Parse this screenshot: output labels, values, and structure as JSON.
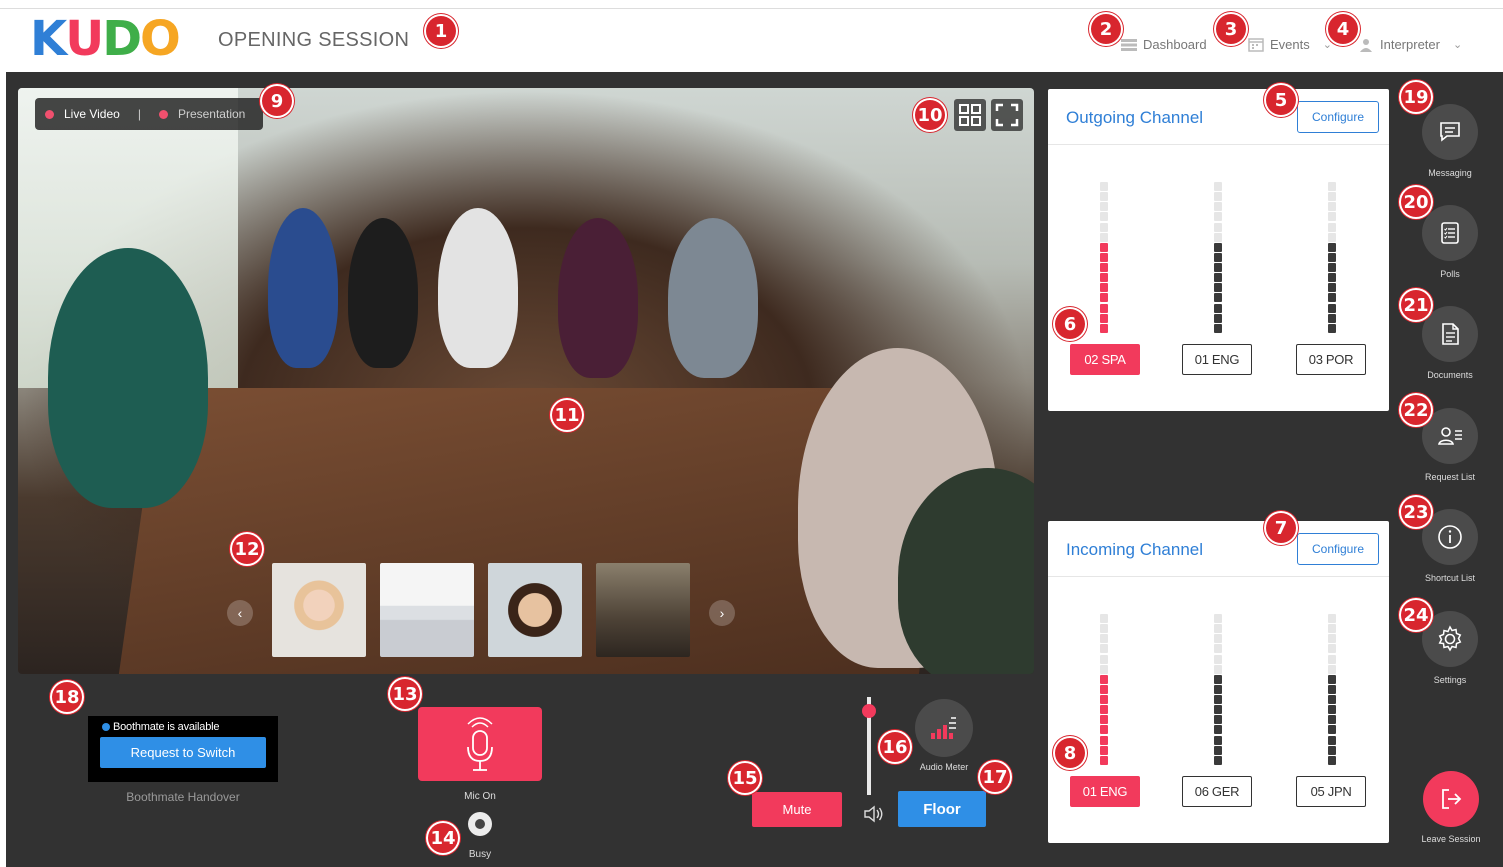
{
  "header": {
    "logo": [
      "K",
      "U",
      "D",
      "O"
    ],
    "logo_colors": [
      "#2f7fd6",
      "#f23a5c",
      "#3fae49",
      "#f6a623"
    ],
    "session_title": "OPENING SESSION",
    "nav": [
      {
        "label": "Dashboard",
        "icon": "dashboard-icon"
      },
      {
        "label": "Events",
        "icon": "calendar-icon"
      },
      {
        "label": "Interpreter",
        "icon": "user-icon"
      }
    ]
  },
  "video": {
    "toggle_live": "Live Video",
    "toggle_separator": "|",
    "toggle_presentation": "Presentation",
    "thumbnails_count": 4
  },
  "outgoing": {
    "title": "Outgoing Channel",
    "configure_label": "Configure",
    "channels": [
      {
        "label": "02 SPA",
        "active": true,
        "level": 0.6
      },
      {
        "label": "01 ENG",
        "active": false,
        "level": 0.6
      },
      {
        "label": "03 POR",
        "active": false,
        "level": 0.6
      }
    ]
  },
  "incoming": {
    "title": "Incoming Channel",
    "configure_label": "Configure",
    "channels": [
      {
        "label": "01 ENG",
        "active": true,
        "level": 0.6
      },
      {
        "label": "06 GER",
        "active": false,
        "level": 0.6
      },
      {
        "label": "05 JPN",
        "active": false,
        "level": 0.6
      }
    ]
  },
  "sidebar": {
    "items": [
      {
        "label": "Messaging",
        "icon": "message-icon"
      },
      {
        "label": "Polls",
        "icon": "polls-icon"
      },
      {
        "label": "Documents",
        "icon": "documents-icon"
      },
      {
        "label": "Request List",
        "icon": "request-list-icon"
      },
      {
        "label": "Shortcut List",
        "icon": "info-icon"
      },
      {
        "label": "Settings",
        "icon": "gear-icon"
      }
    ],
    "leave_label": "Leave Session"
  },
  "controls": {
    "boothmate_status": "Boothmate is available",
    "request_switch": "Request to Switch",
    "handover_label": "Boothmate Handover",
    "mic_label": "Mic On",
    "busy_label": "Busy",
    "mute_label": "Mute",
    "floor_label": "Floor",
    "audio_meter_label": "Audio Meter",
    "volume_level": 0.93
  },
  "badges": [
    "1",
    "2",
    "3",
    "4",
    "5",
    "6",
    "7",
    "8",
    "9",
    "10",
    "11",
    "12",
    "13",
    "14",
    "15",
    "16",
    "17",
    "18",
    "19",
    "20",
    "21",
    "22",
    "23",
    "24"
  ],
  "colors": {
    "accent_red": "#f23a5c",
    "accent_blue": "#2f8fe6",
    "badge_red": "#d8262e",
    "dark_bg": "#323232"
  }
}
